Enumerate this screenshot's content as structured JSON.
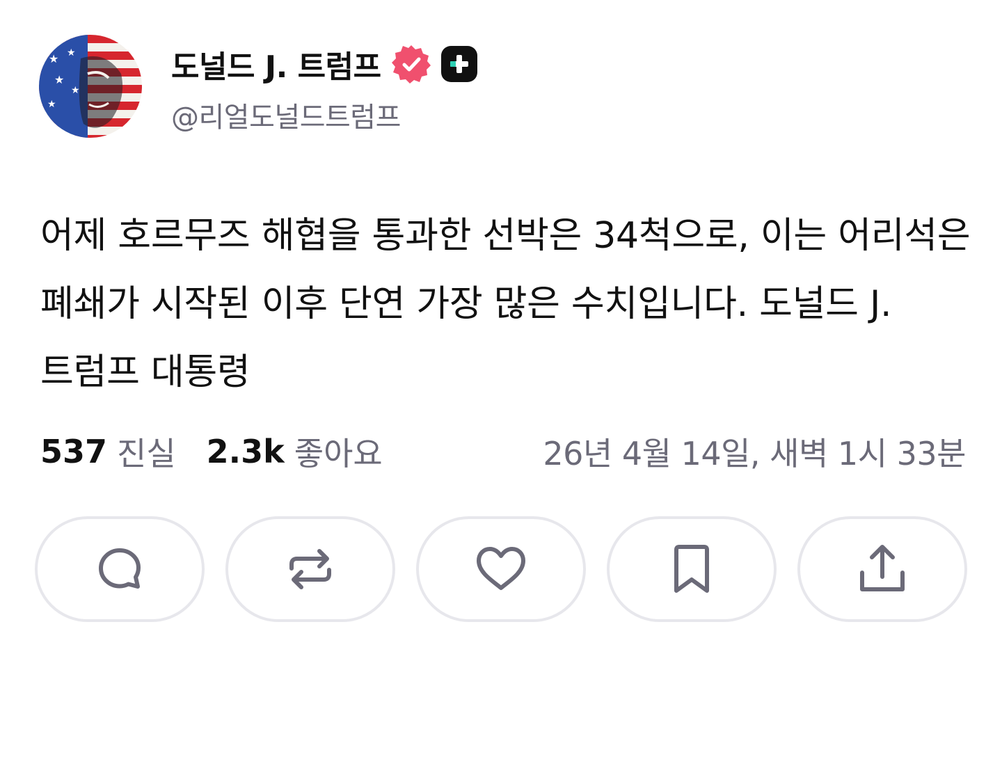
{
  "author": {
    "display_name": "도널드 J. 트럼프",
    "handle": "@리얼도널드트럼프",
    "avatar_icon": "flag-portrait-avatar",
    "verified_icon": "verified-badge-icon",
    "verified_color": "#f0506e",
    "plus_icon": "plus-badge-icon"
  },
  "post": {
    "text": "어제 호르무즈 해협을 통과한 선박은 34척으로, 이는 어리석은 폐쇄가 시작된 이후 단연 가장 많은 수치입니다. 도널드 J. 트럼프 대통령"
  },
  "stats": {
    "truths_count": "537",
    "truths_label": "진실",
    "likes_count": "2.3k",
    "likes_label": "좋아요",
    "timestamp": "26년 4월 14일, 새벽 1시 33분"
  },
  "actions": [
    {
      "name": "reply",
      "icon": "comment-icon"
    },
    {
      "name": "repost",
      "icon": "repost-icon"
    },
    {
      "name": "like",
      "icon": "heart-icon"
    },
    {
      "name": "bookmark",
      "icon": "bookmark-icon"
    },
    {
      "name": "share",
      "icon": "share-icon"
    }
  ],
  "colors": {
    "text_primary": "#111111",
    "text_secondary": "#6b6a78",
    "button_border": "#e7e7ec",
    "icon_color": "#6b6a78"
  }
}
